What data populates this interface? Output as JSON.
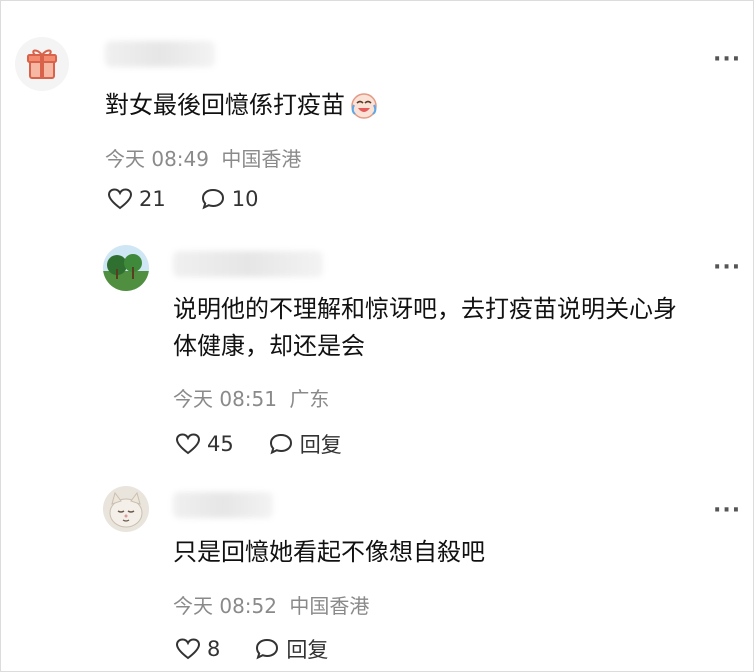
{
  "comments": [
    {
      "content": "對女最後回憶係打疫苗",
      "emoji": "cry-laugh-emoji",
      "time": "今天 08:49",
      "location": "中国香港",
      "likes": "21",
      "replies": "10",
      "avatar": "gift-icon"
    },
    {
      "content_line1": "说明他的不理解和惊讶吧，去打疫苗说明关心身",
      "content_line2": "体健康，却还是会",
      "time": "今天 08:51",
      "location": "广东",
      "likes": "45",
      "reply_label": "回复",
      "avatar": "landscape-avatar"
    },
    {
      "content": "只是回憶她看起不像想自殺吧",
      "time": "今天 08:52",
      "location": "中国香港",
      "likes": "8",
      "reply_label": "回复",
      "avatar": "cat-avatar"
    }
  ],
  "more_label": "···",
  "colors": {
    "text": "#111111",
    "meta": "#8a8a8a",
    "icon": "#333333"
  }
}
